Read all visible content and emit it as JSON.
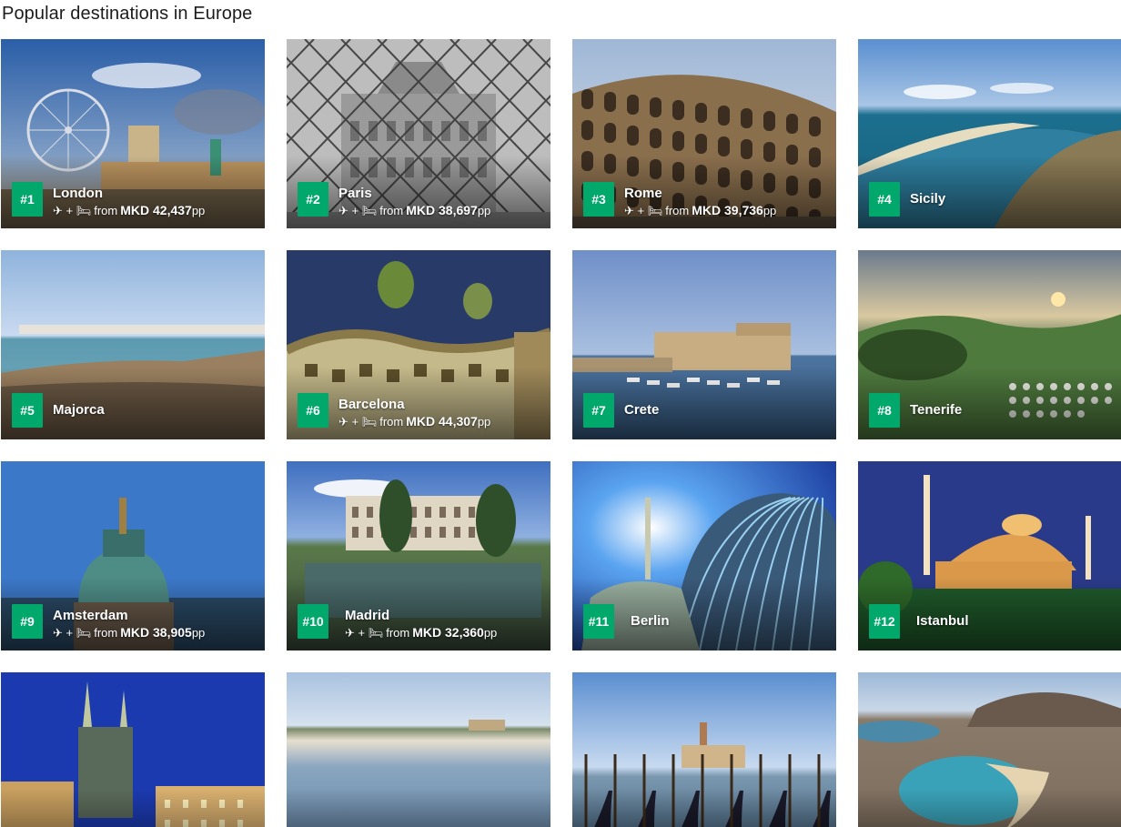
{
  "heading": "Popular destinations in Europe",
  "colors": {
    "badge": "#00a86b",
    "text": "#1c1c1c"
  },
  "deal_icons": "✈ + 🛏",
  "deal_prefix": "from",
  "deal_suffix": "pp",
  "destinations": [
    {
      "rank": "#1",
      "city": "London",
      "price": "MKD 42,437",
      "scene": "london"
    },
    {
      "rank": "#2",
      "city": "Paris",
      "price": "MKD 38,697",
      "scene": "paris"
    },
    {
      "rank": "#3",
      "city": "Rome",
      "price": "MKD 39,736",
      "scene": "rome"
    },
    {
      "rank": "#4",
      "city": "Sicily",
      "price": "",
      "scene": "sicily"
    },
    {
      "rank": "#5",
      "city": "Majorca",
      "price": "",
      "scene": "majorca"
    },
    {
      "rank": "#6",
      "city": "Barcelona",
      "price": "MKD 44,307",
      "scene": "barcelona"
    },
    {
      "rank": "#7",
      "city": "Crete",
      "price": "",
      "scene": "crete"
    },
    {
      "rank": "#8",
      "city": "Tenerife",
      "price": "",
      "scene": "tenerife"
    },
    {
      "rank": "#9",
      "city": "Amsterdam",
      "price": "MKD 38,905",
      "scene": "amsterdam"
    },
    {
      "rank": "#10",
      "city": "Madrid",
      "price": "MKD 32,360",
      "scene": "madrid"
    },
    {
      "rank": "#11",
      "city": "Berlin",
      "price": "",
      "scene": "berlin"
    },
    {
      "rank": "#12",
      "city": "Istanbul",
      "price": "",
      "scene": "istanbul"
    },
    {
      "rank": "",
      "city": "",
      "price": "",
      "scene": "prague"
    },
    {
      "rank": "",
      "city": "",
      "price": "",
      "scene": "sardinia"
    },
    {
      "rank": "",
      "city": "",
      "price": "",
      "scene": "venice"
    },
    {
      "rank": "",
      "city": "",
      "price": "",
      "scene": "lanzarote"
    }
  ]
}
